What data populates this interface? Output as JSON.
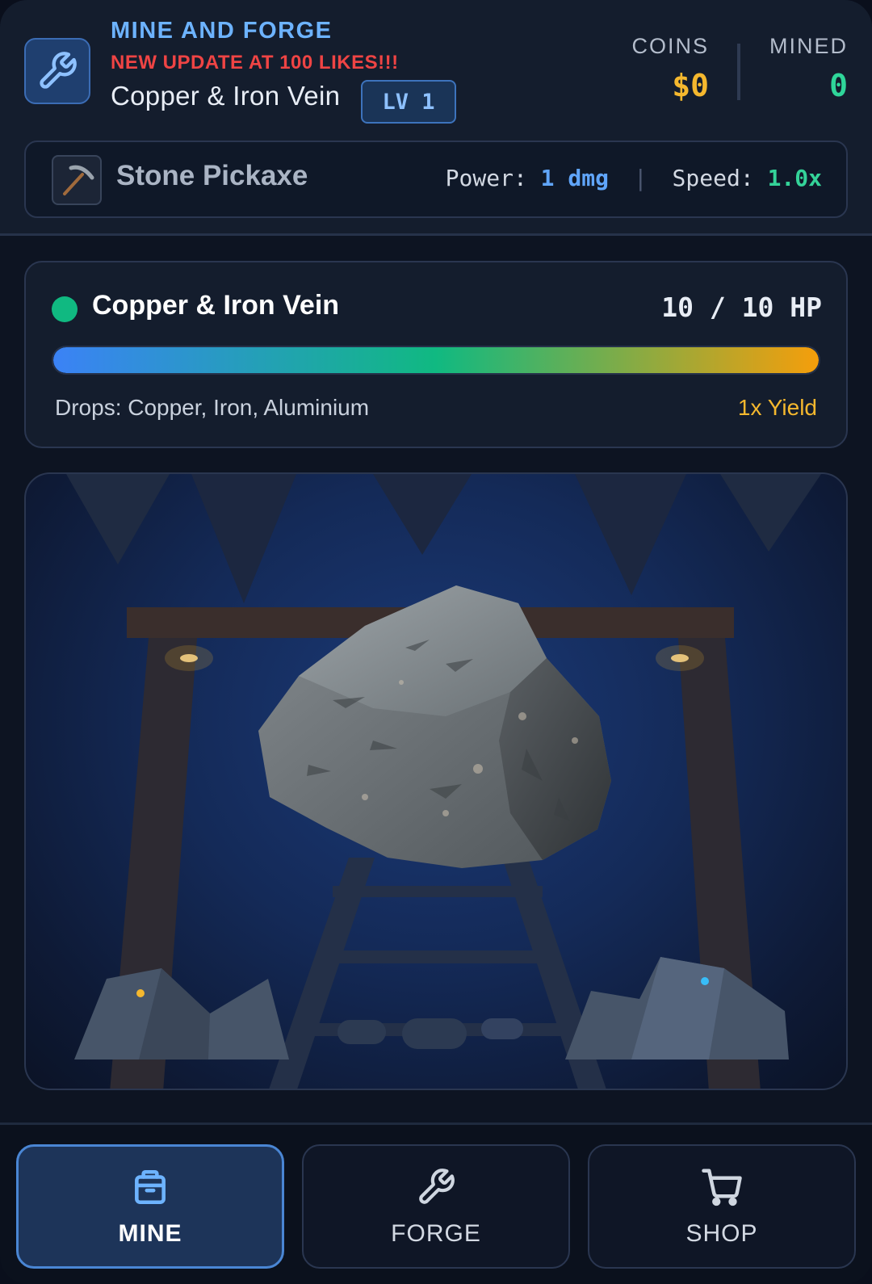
{
  "header": {
    "title": "MINE AND FORGE",
    "announcement": "NEW UPDATE AT 100 LIKES!!!",
    "vein_name": "Copper & Iron Vein",
    "level_label": "LV 1",
    "app_icon": "wrench-icon"
  },
  "stats": {
    "coins_label": "COINS",
    "coins_value": "$0",
    "mined_label": "MINED",
    "mined_value": "0"
  },
  "tool": {
    "icon": "pickaxe-icon",
    "name": "Stone Pickaxe",
    "power_label": "Power:",
    "power_value": "1 dmg",
    "speed_label": "Speed:",
    "speed_value": "1.0x",
    "separator": "|"
  },
  "vein": {
    "status_color": "#10b981",
    "name": "Copper & Iron Vein",
    "hp_current": "10",
    "hp_max": "10",
    "hp_separator": "/",
    "hp_unit": "HP",
    "hp_fraction": 1.0,
    "drops_text": "Drops: Copper, Iron, Aluminium",
    "yield_text": "1x Yield"
  },
  "scene": {
    "object": "rock-boulder",
    "lamps": 2
  },
  "nav": {
    "items": [
      {
        "label": "MINE",
        "icon": "backpack-icon",
        "active": true
      },
      {
        "label": "FORGE",
        "icon": "wrench-icon",
        "active": false
      },
      {
        "label": "SHOP",
        "icon": "cart-icon",
        "active": false
      }
    ]
  },
  "colors": {
    "accent_blue": "#60a5fa",
    "coins_gold": "#f5b82e",
    "mined_green": "#2fd69a",
    "alert_red": "#ef4444"
  }
}
